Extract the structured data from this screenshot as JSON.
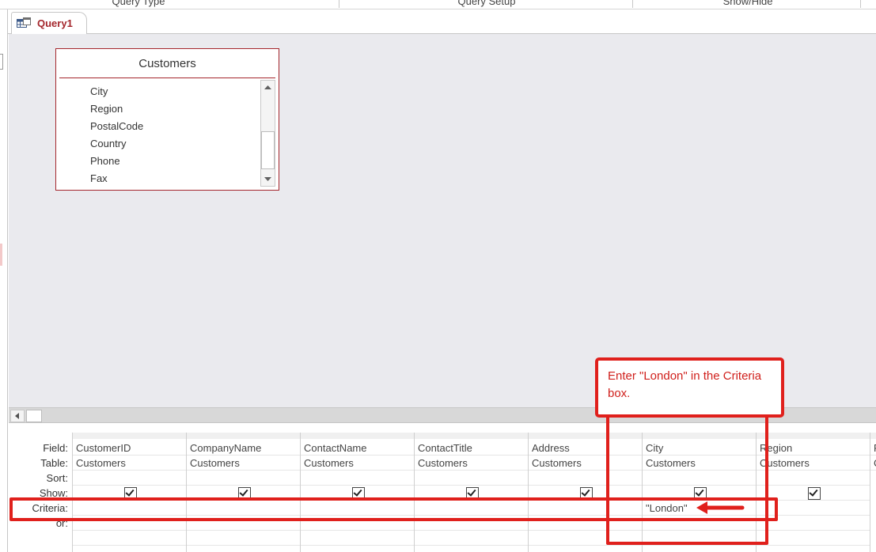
{
  "ribbon": {
    "groups": [
      "Query Type",
      "Query Setup",
      "Show/Hide"
    ]
  },
  "document_tab": {
    "label": "Query1",
    "icon": "query-design-icon"
  },
  "field_list": {
    "title": "Customers",
    "items": [
      "City",
      "Region",
      "PostalCode",
      "Country",
      "Phone",
      "Fax"
    ]
  },
  "grid": {
    "row_labels": {
      "field": "Field:",
      "table": "Table:",
      "sort": "Sort:",
      "show": "Show:",
      "criteria": "Criteria:",
      "or": "or:"
    },
    "columns": [
      {
        "field": "CustomerID",
        "table": "Customers",
        "show": true,
        "criteria": ""
      },
      {
        "field": "CompanyName",
        "table": "Customers",
        "show": true,
        "criteria": ""
      },
      {
        "field": "ContactName",
        "table": "Customers",
        "show": true,
        "criteria": ""
      },
      {
        "field": "ContactTitle",
        "table": "Customers",
        "show": true,
        "criteria": ""
      },
      {
        "field": "Address",
        "table": "Customers",
        "show": true,
        "criteria": ""
      },
      {
        "field": "City",
        "table": "Customers",
        "show": true,
        "criteria": "\"London\""
      },
      {
        "field": "Region",
        "table": "Customers",
        "show": true,
        "criteria": ""
      },
      {
        "field": "P",
        "table": "C",
        "show": false,
        "criteria": ""
      }
    ]
  },
  "callout": {
    "text": "Enter \"London\" in the Criteria box."
  },
  "colors": {
    "accent": "#a4262c",
    "annotation": "#e0201c",
    "design_background": "#eaeaee"
  }
}
